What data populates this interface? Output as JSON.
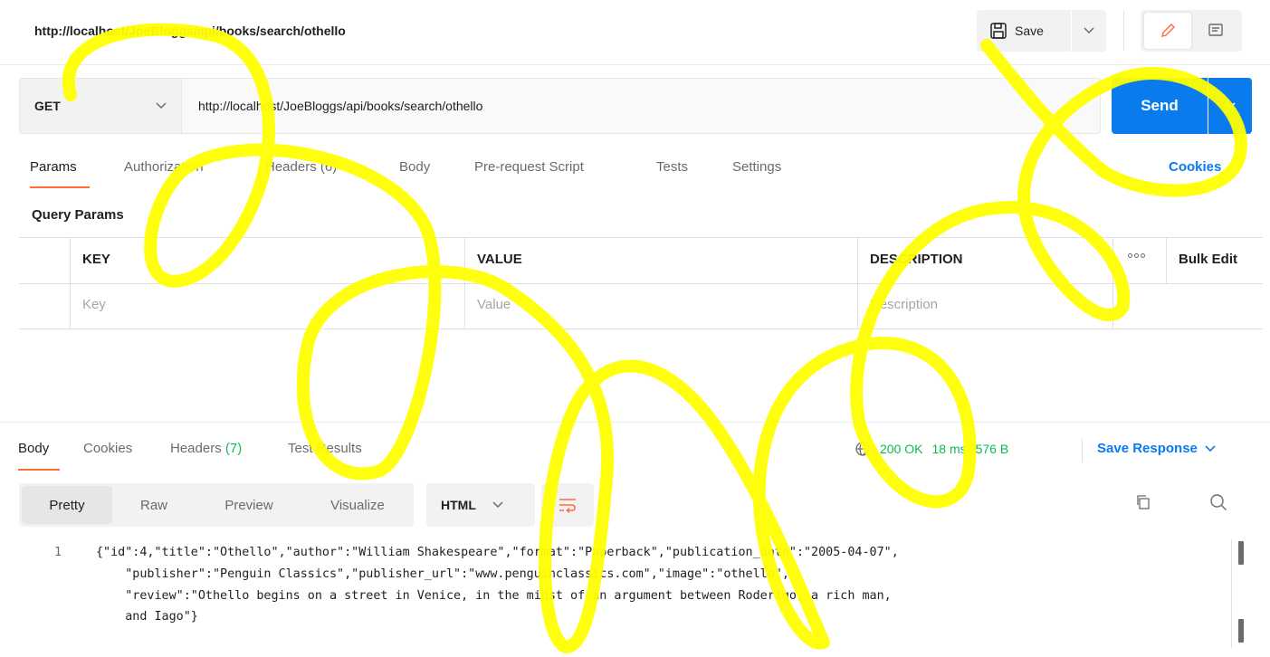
{
  "header": {
    "title": "http://localhost/JoeBloggs/api/books/search/othello",
    "save_label": "Save"
  },
  "request": {
    "method": "GET",
    "url": "http://localhost/JoeBloggs/api/books/search/othello",
    "send_label": "Send"
  },
  "request_tabs": [
    {
      "label": "Params"
    },
    {
      "label": "Authorization"
    },
    {
      "label": "Headers (6)"
    },
    {
      "label": "Body"
    },
    {
      "label": "Pre-request Script"
    },
    {
      "label": "Tests"
    },
    {
      "label": "Settings"
    }
  ],
  "cookies_label": "Cookies",
  "query_params": {
    "heading": "Query Params",
    "columns": [
      "KEY",
      "VALUE",
      "DESCRIPTION"
    ],
    "bulk_edit_label": "Bulk Edit",
    "placeholders": {
      "key": "Key",
      "value": "Value",
      "description": "Description"
    }
  },
  "response": {
    "tabs": [
      {
        "label": "Body"
      },
      {
        "label": "Cookies"
      },
      {
        "label": "Headers (7)"
      },
      {
        "label": "Test Results"
      }
    ],
    "status": "200 OK",
    "time": "18 ms",
    "size": "576 B",
    "save_response_label": "Save Response",
    "view_tabs": [
      "Pretty",
      "Raw",
      "Preview",
      "Visualize"
    ],
    "format": "HTML",
    "code_lines": [
      {
        "number": "1",
        "text": "{\"id\":4,\"title\":\"Othello\",\"author\":\"William Shakespeare\",\"format\":\"Paperback\",\"publication_date\":\"2005-04-07\","
      },
      {
        "number": "",
        "text": "    \"publisher\":\"Penguin Classics\",\"publisher_url\":\"www.penguinclassics.com\",\"image\":\"othello\","
      },
      {
        "number": "",
        "text": "    \"review\":\"Othello begins on a street in Venice, in the midst of an argument between Roderigo, a rich man,"
      },
      {
        "number": "",
        "text": "    and Iago\"}"
      }
    ]
  },
  "colors": {
    "accent_orange": "#ff6c37",
    "primary_blue": "#097bed",
    "status_green": "#0cbb52",
    "scribble_yellow": "#ffff00"
  }
}
